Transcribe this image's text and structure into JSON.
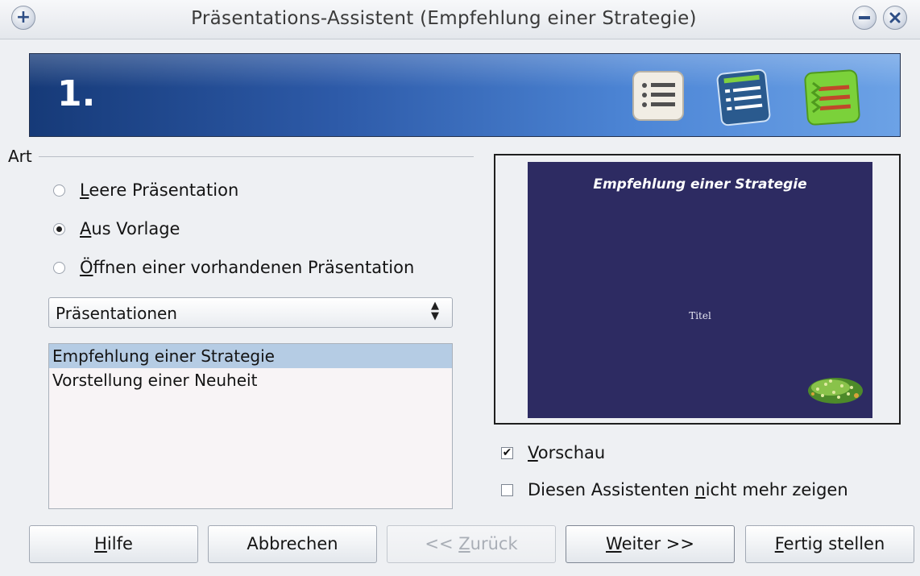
{
  "window": {
    "title": "Präsentations-Assistent (Empfehlung einer Strategie)",
    "add_icon": "plus-icon",
    "minimize_icon": "minimize-icon",
    "close_icon": "close-icon"
  },
  "banner": {
    "step_number": "1.",
    "icons": [
      "list-plain-icon",
      "list-blue-icon",
      "list-green-icon"
    ]
  },
  "type_group": {
    "legend": "Art",
    "options": [
      {
        "mnemonic": "L",
        "rest": "eere Präsentation",
        "selected": false
      },
      {
        "mnemonic": "A",
        "rest": "us Vorlage",
        "selected": true
      },
      {
        "mnemonic": "Ö",
        "rest": "ffnen einer vorhandenen Präsentation",
        "selected": false
      }
    ]
  },
  "category_select": {
    "value": "Präsentationen"
  },
  "template_list": {
    "items": [
      "Empfehlung einer Strategie",
      "Vorstellung einer Neuheit"
    ],
    "selected_index": 0
  },
  "preview": {
    "slide_title": "Empfehlung einer Strategie",
    "slide_subtitle": "Titel",
    "slide_background": "#2d2b62"
  },
  "options": {
    "preview_checkbox": {
      "mnemonic": "V",
      "rest": "orschau",
      "checked": true
    },
    "dont_show_checkbox": {
      "before": "Diesen Assistenten ",
      "mnemonic": "n",
      "after": "icht mehr zeigen",
      "checked": false
    }
  },
  "buttons": {
    "help": {
      "mnemonic": "H",
      "rest": "ilfe"
    },
    "cancel": {
      "label": "Abbrechen"
    },
    "back": {
      "before": "<< ",
      "mnemonic": "Z",
      "after": "urück"
    },
    "next": {
      "mnemonic": "W",
      "after": "eiter >>"
    },
    "finish": {
      "mnemonic": "F",
      "after": "ertig stellen"
    }
  }
}
